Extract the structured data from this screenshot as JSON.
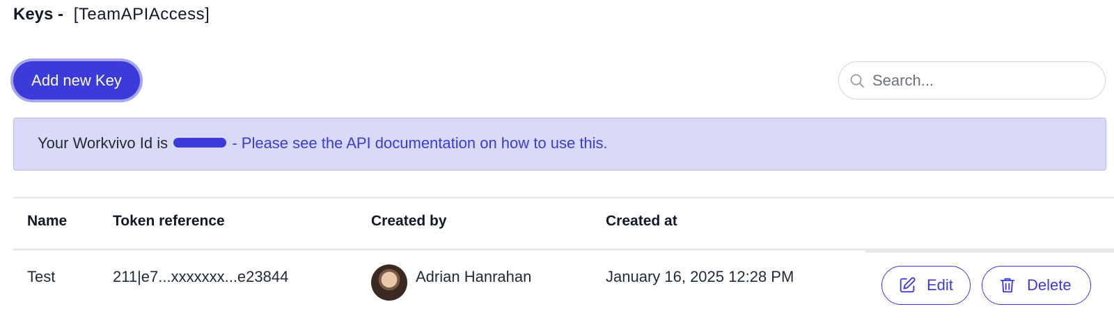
{
  "header": {
    "title_bold": "Keys",
    "separator": "-",
    "team_name": "[TeamAPIAccess]"
  },
  "toolbar": {
    "add_label": "Add new Key",
    "search_placeholder": "Search..."
  },
  "banner": {
    "prefix": "Your Workvivo Id is",
    "link_text": "- Please see the API documentation on how to use this."
  },
  "table": {
    "columns": [
      "Name",
      "Token reference",
      "Created by",
      "Created at"
    ],
    "rows": [
      {
        "name": "Test",
        "token_reference": "211|e7...xxxxxxx...e23844",
        "created_by": "Adrian Hanrahan",
        "created_at": "January 16, 2025 12:28 PM",
        "edit_label": "Edit",
        "delete_label": "Delete"
      }
    ]
  },
  "colors": {
    "accent": "#3b3bd9",
    "banner_bg": "#d9daf7"
  },
  "icons": {
    "search": "search-icon",
    "edit": "pencil-square-icon",
    "delete": "trash-icon"
  }
}
